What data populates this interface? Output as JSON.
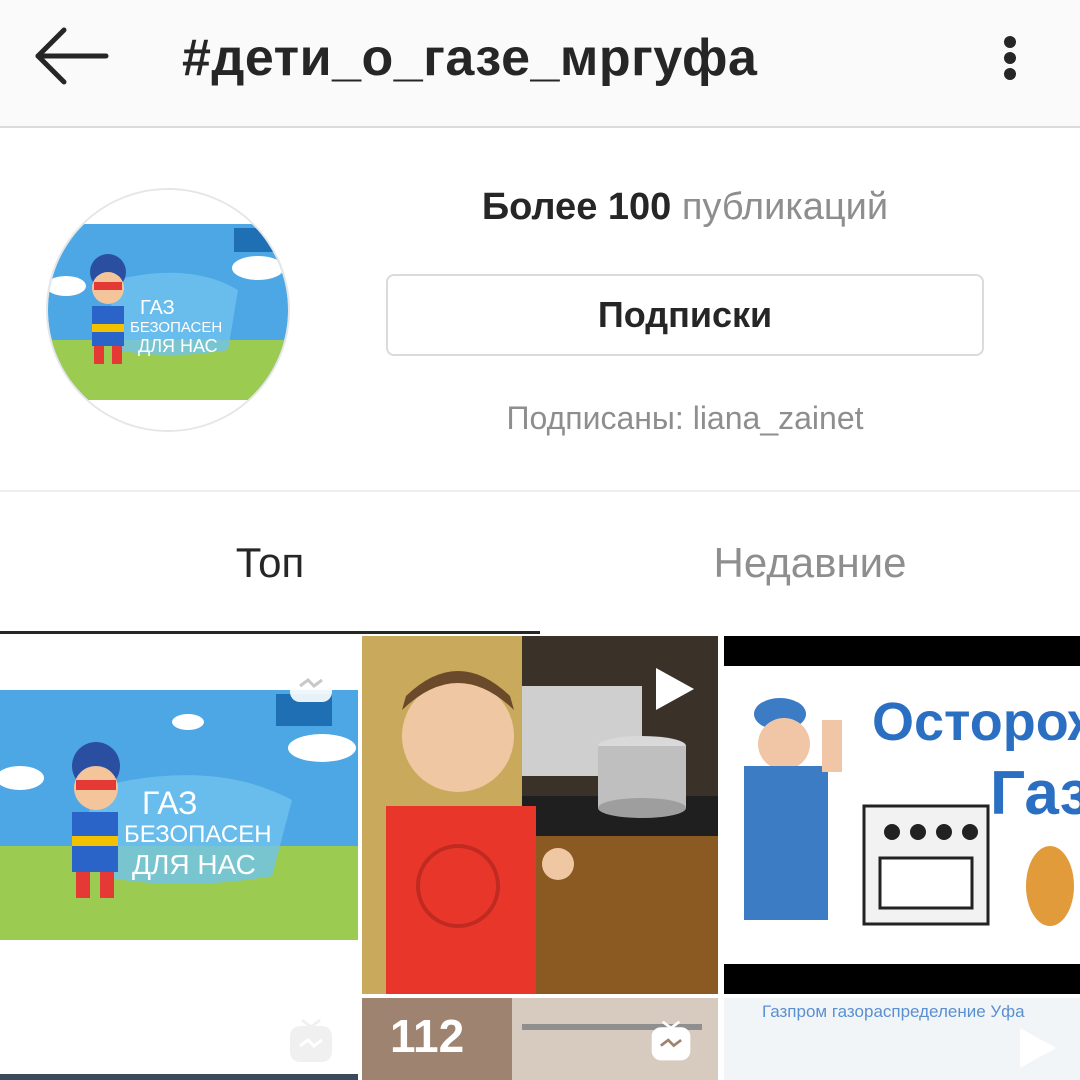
{
  "header": {
    "title": "#дети_о_газе_мргуфа",
    "back_icon": "arrow-left-icon",
    "menu_icon": "more-vertical-icon"
  },
  "profile": {
    "posts_count": "Более 100",
    "posts_label": "публикаций",
    "follow_button": "Подписки",
    "followed_by": "Подписаны: liana_zainet",
    "avatar_text": [
      "ГАЗ",
      "БЕЗОПАСЕН",
      "ДЛЯ НАС"
    ]
  },
  "tabs": {
    "top": "Топ",
    "recent": "Недавние"
  },
  "grid": {
    "post1": {
      "text": [
        "ГАЗ",
        "БЕЗОПАСЕН",
        "ДЛЯ НАС"
      ],
      "icon": "igtv-icon"
    },
    "post2": {
      "icon": "play-icon"
    },
    "post3": {
      "text1": "Осторожно",
      "text2": "Газ",
      "icon": "play-icon"
    },
    "post4": {
      "icon": "igtv-icon"
    },
    "post5": {
      "number": "112",
      "icon": "igtv-icon"
    },
    "post6": {
      "caption": "Газпром газораспределение Уфа",
      "icon": "play-icon"
    }
  },
  "colors": {
    "text": "#262626",
    "muted": "#8e8e8e",
    "border": "#dbdbdb",
    "sky": "#4da7e4",
    "grass": "#9ccb52"
  }
}
